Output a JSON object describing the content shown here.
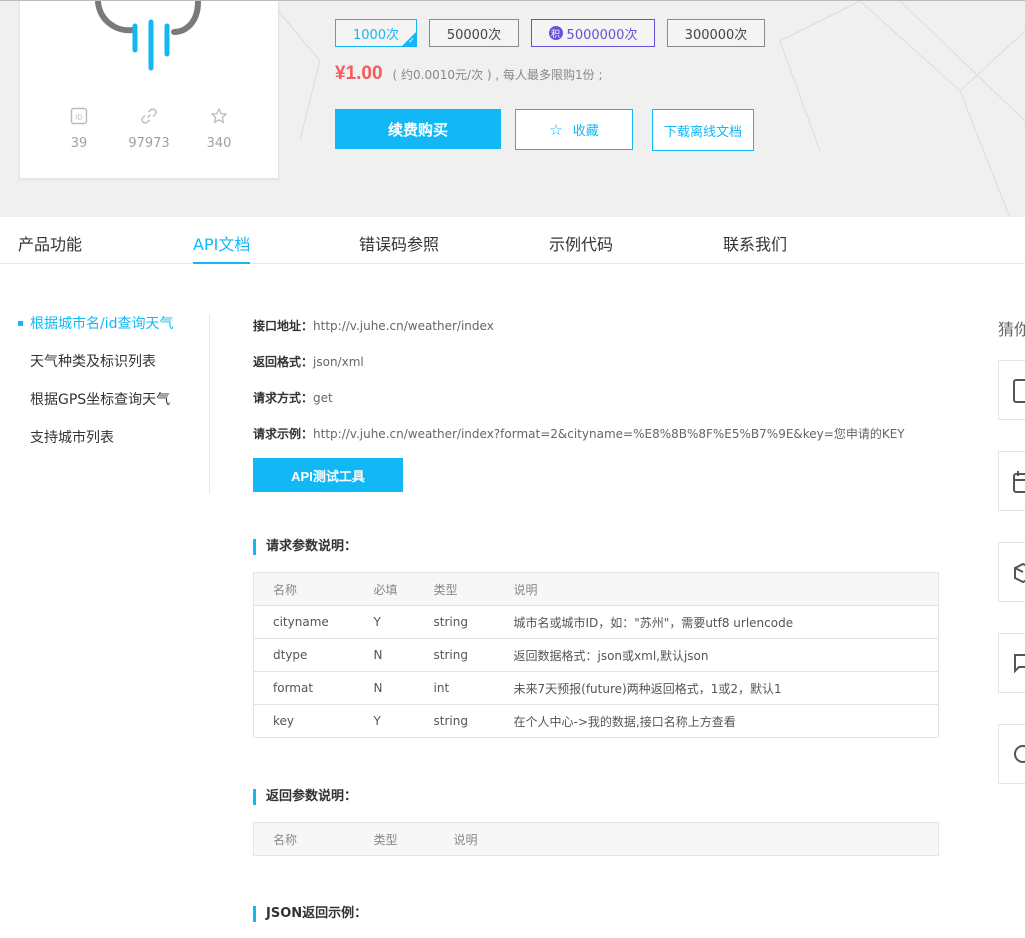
{
  "product": {
    "stats": [
      {
        "icon": "id-icon",
        "value": "39"
      },
      {
        "icon": "link-icon",
        "value": "97973"
      },
      {
        "icon": "star-icon",
        "value": "340"
      }
    ]
  },
  "packages": [
    {
      "label": "1000次",
      "state": "active"
    },
    {
      "label": "50000次",
      "state": "normal"
    },
    {
      "label": "5000000次",
      "state": "bonus",
      "badge": "积"
    },
    {
      "label": "300000次",
      "state": "normal"
    }
  ],
  "price": {
    "amount": "¥1.00",
    "note": "( 约0.0010元/次 ) , 每人最多限购1份 ;"
  },
  "actions": {
    "buy": "续费购买",
    "favorite": "收藏",
    "download": "下载离线文档"
  },
  "tabs": [
    "产品功能",
    "API文档",
    "错误码参照",
    "示例代码",
    "联系我们"
  ],
  "side_nav": [
    "根据城市名/id查询天气",
    "天气种类及标识列表",
    "根据GPS坐标查询天气",
    "支持城市列表"
  ],
  "api": {
    "url_label": "接口地址：",
    "url": "http://v.juhe.cn/weather/index",
    "format_label": "返回格式：",
    "format": "json/xml",
    "method_label": "请求方式：",
    "method": "get",
    "example_label": "请求示例：",
    "example": "http://v.juhe.cn/weather/index?format=2&cityname=%E8%8B%8F%E5%B7%9E&key=您申请的KEY",
    "test_button": "API测试工具"
  },
  "request_params": {
    "title": "请求参数说明：",
    "headers": [
      "名称",
      "必填",
      "类型",
      "说明"
    ],
    "rows": [
      [
        "cityname",
        "Y",
        "string",
        "城市名或城市ID，如：\"苏州\"，需要utf8 urlencode"
      ],
      [
        "dtype",
        "N",
        "string",
        "返回数据格式：json或xml,默认json"
      ],
      [
        "format",
        "N",
        "int",
        "未来7天预报(future)两种返回格式，1或2，默认1"
      ],
      [
        "key",
        "Y",
        "string",
        "在个人中心->我的数据,接口名称上方查看"
      ]
    ]
  },
  "return_params": {
    "title": "返回参数说明：",
    "headers": [
      "名称",
      "类型",
      "说明"
    ]
  },
  "json_example": {
    "title": "JSON返回示例："
  },
  "right_rail": {
    "title": "猜你"
  },
  "colors": {
    "accent": "#12b8f5",
    "price": "#f55b5b",
    "bonus": "#6a50d8"
  }
}
